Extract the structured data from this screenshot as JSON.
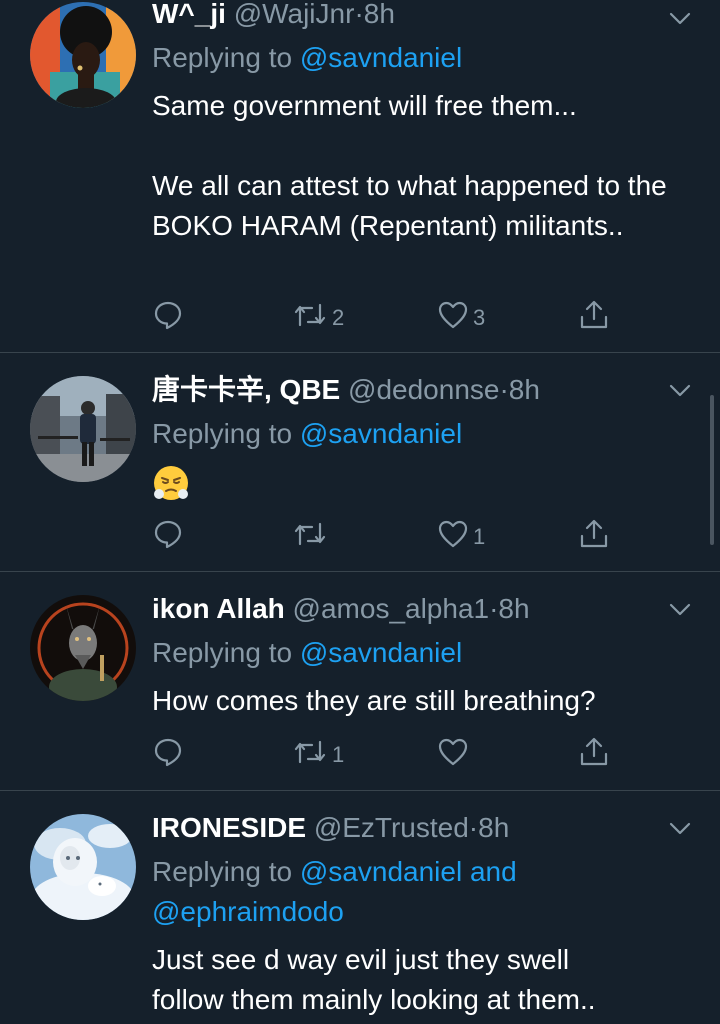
{
  "tweets": [
    {
      "name": "W^_ji",
      "handle": "@WajiJnr",
      "dot": "·",
      "time": "8h",
      "replying_prefix": "Replying to",
      "replying_to": "@savndaniel",
      "text": "Same government will free them...\n\nWe all can attest to what happened to the BOKO HARAM (Repentant) militants..",
      "actions": {
        "reply": "",
        "retweet": "2",
        "like": "3"
      }
    },
    {
      "name": "唐卡卡辛, QBE",
      "handle": "@dedonnse",
      "dot": "·",
      "time": "8h",
      "replying_prefix": "Replying to",
      "replying_to": "@savndaniel",
      "emoji": "face-with-steam-from-nose",
      "actions": {
        "reply": "",
        "retweet": "",
        "like": "1"
      }
    },
    {
      "name": "ikon Allah",
      "handle": "@amos_alpha1",
      "dot": "·",
      "time": "8h",
      "replying_prefix": "Replying to",
      "replying_to": "@savndaniel",
      "text": "How comes they are still breathing?",
      "actions": {
        "reply": "",
        "retweet": "1",
        "like": ""
      }
    },
    {
      "name": "IRONESIDE",
      "handle": "@EzTrusted",
      "dot": "·",
      "time": "8h",
      "replying_prefix": "Replying to",
      "replying_to": "@savndaniel and",
      "replying_to_2": "@ephraimdodo",
      "text": "Just see d way evil just they swell\nfollow them mainly looking at them..",
      "actions": {
        "reply": "",
        "retweet": "",
        "like": ""
      }
    }
  ],
  "icons": {
    "reply": "reply-icon",
    "retweet": "retweet-icon",
    "like": "heart-icon",
    "share": "share-icon",
    "more": "chevron-down-icon"
  },
  "colors": {
    "background": "#15202b",
    "divider": "#38444d",
    "secondary_text": "#8899a6",
    "link": "#1da1f2",
    "primary_text": "#ffffff"
  }
}
